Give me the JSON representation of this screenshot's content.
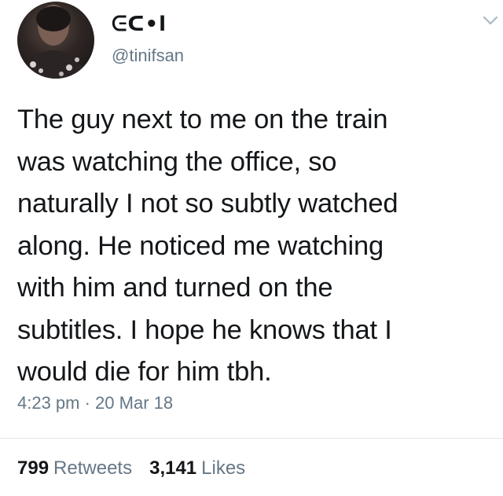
{
  "user": {
    "display_name": "ᕮᑕ•l",
    "handle": "@tinifsan"
  },
  "icons": {
    "avatar": "profile-photo",
    "menu": "chevron-down-icon"
  },
  "tweet": {
    "text": "The guy next to me on the train\nwas watching the office, so\nnaturally I not so subtly watched\nalong. He noticed me watching\nwith him and turned on the\nsubtitles. I hope he knows that I\nwould die for him tbh.",
    "timestamp": "4:23 pm · 20 Mar 18"
  },
  "stats": {
    "retweets_count": "799",
    "retweets_label": "Retweets",
    "likes_count": "3,141",
    "likes_label": "Likes"
  },
  "colors": {
    "text": "#14171a",
    "secondary": "#657786",
    "divider": "#e1e8ed"
  }
}
